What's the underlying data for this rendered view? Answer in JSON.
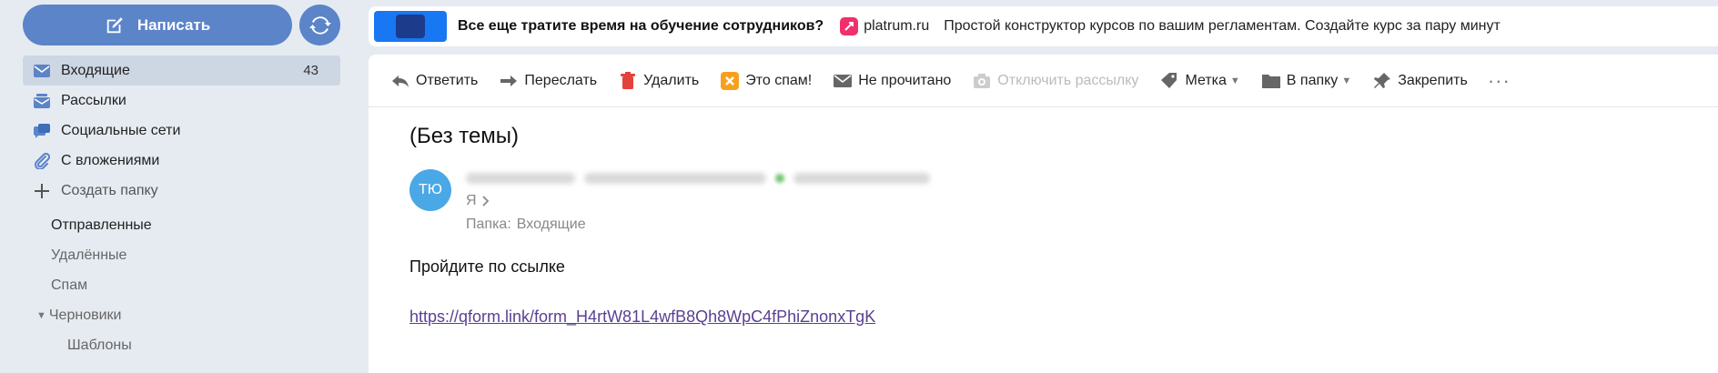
{
  "sidebar": {
    "compose_label": "Написать",
    "folders": [
      {
        "label": "Входящие",
        "count": "43",
        "icon": "inbox-icon"
      },
      {
        "label": "Рассылки",
        "icon": "newsletters-icon"
      },
      {
        "label": "Социальные сети",
        "icon": "social-networks-icon"
      },
      {
        "label": "С вложениями",
        "icon": "paperclip-icon"
      },
      {
        "label": "Создать папку",
        "icon": "plus-icon"
      }
    ],
    "system_folders": [
      {
        "label": "Отправленные"
      },
      {
        "label": "Удалённые"
      },
      {
        "label": "Спам"
      },
      {
        "label": "Черновики"
      },
      {
        "label": "Шаблоны"
      }
    ]
  },
  "ad": {
    "title": "Все еще тратите время на обучение сотрудников?",
    "domain": "platrum.ru",
    "description": "Простой конструктор курсов по вашим регламентам. Создайте курс за пару минут"
  },
  "toolbar": {
    "reply": "Ответить",
    "forward": "Переслать",
    "delete": "Удалить",
    "spam": "Это спам!",
    "unread": "Не прочитано",
    "unsubscribe": "Отключить рассылку",
    "label": "Метка",
    "move": "В папку",
    "pin": "Закрепить",
    "more": "···"
  },
  "message": {
    "subject": "(Без темы)",
    "avatar_initials": "ТЮ",
    "to": "Я",
    "folder_label": "Папка:",
    "folder_value": "Входящие",
    "body_text": "Пройдите по ссылке",
    "link": "https://qform.link/form_H4rtW81L4wfB8Qh8WpC4fPhiZnonxTgK"
  },
  "colors": {
    "accent": "#5b84c9",
    "avatar": "#4aa8e6",
    "link": "#5a3f91",
    "active_folder": "#cdd6e3"
  }
}
